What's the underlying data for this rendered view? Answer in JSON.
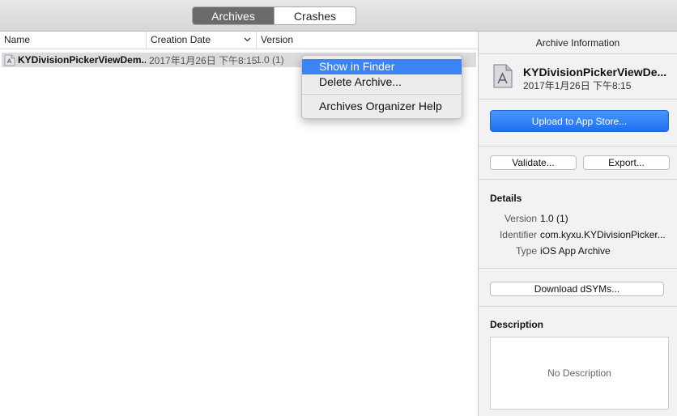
{
  "toolbar": {
    "tabs": [
      {
        "label": "Archives",
        "active": true
      },
      {
        "label": "Crashes",
        "active": false
      }
    ]
  },
  "table": {
    "columns": [
      "Name",
      "Creation Date",
      "Version"
    ],
    "sort_icon": "chevron-down-icon",
    "rows": [
      {
        "name": "KYDivisionPickerViewDem...",
        "date": "2017年1月26日 下午8:15",
        "version": "1.0 (1)",
        "selected": true
      }
    ]
  },
  "context_menu": {
    "items": [
      "Show in Finder",
      "Delete Archive...",
      "Archives Organizer Help"
    ],
    "highlighted": "Show in Finder"
  },
  "inspector": {
    "title": "Archive Information",
    "archive_name": "KYDivisionPickerViewDe...",
    "archive_date": "2017年1月26日 下午8:15",
    "upload_label": "Upload to App Store...",
    "validate_label": "Validate...",
    "export_label": "Export...",
    "details_heading": "Details",
    "details": {
      "version_key": "Version",
      "version_value": "1.0 (1)",
      "identifier_key": "Identifier",
      "identifier_value": "com.kyxu.KYDivisionPicker...",
      "type_key": "Type",
      "type_value": "iOS App Archive"
    },
    "dsyms_label": "Download dSYMs...",
    "description_heading": "Description",
    "description_placeholder": "No Description"
  },
  "colors": {
    "accent": "#3b83f7",
    "primary_button": "#1e6ff0",
    "segment_active": "#6b6b6b"
  }
}
